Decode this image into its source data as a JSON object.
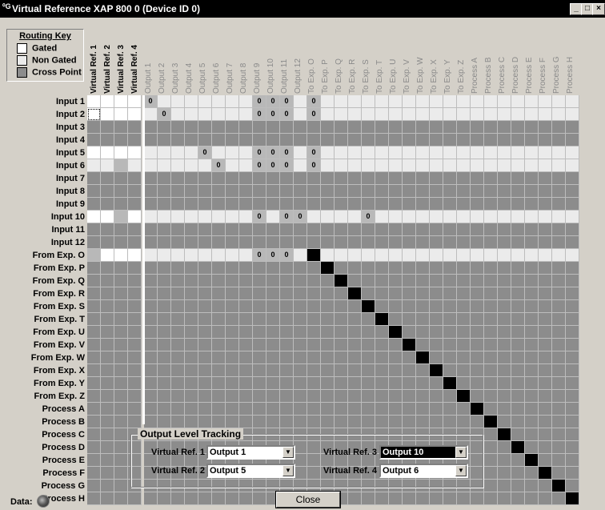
{
  "window": {
    "title": "Virtual Reference XAP 800 0 (Device ID 0)",
    "buttons": [
      "_",
      "□",
      "×"
    ]
  },
  "routing_key": {
    "title": "Routing Key",
    "items": [
      {
        "label": "Gated",
        "color": "#ffffff"
      },
      {
        "label": "Non Gated",
        "color": "#ebebeb"
      },
      {
        "label": "Cross Point",
        "color": "#8c8c8c"
      }
    ]
  },
  "columns": [
    {
      "label": "Virtual Ref. 1",
      "bold": true
    },
    {
      "label": "Virtual Ref. 2",
      "bold": true
    },
    {
      "label": "Virtual Ref. 3",
      "bold": true
    },
    {
      "label": "Virtual Ref. 4",
      "bold": true
    },
    {
      "label": "Output 1"
    },
    {
      "label": "Output 2"
    },
    {
      "label": "Output 3"
    },
    {
      "label": "Output 4"
    },
    {
      "label": "Output 5"
    },
    {
      "label": "Output 6"
    },
    {
      "label": "Output 7"
    },
    {
      "label": "Output 8"
    },
    {
      "label": "Output 9"
    },
    {
      "label": "Output 10"
    },
    {
      "label": "Output 11"
    },
    {
      "label": "Output 12"
    },
    {
      "label": "To Exp. O"
    },
    {
      "label": "To Exp. P"
    },
    {
      "label": "To Exp. Q"
    },
    {
      "label": "To Exp. R"
    },
    {
      "label": "To Exp. S"
    },
    {
      "label": "To Exp. T"
    },
    {
      "label": "To Exp. U"
    },
    {
      "label": "To Exp. V"
    },
    {
      "label": "To Exp. W"
    },
    {
      "label": "To Exp. X"
    },
    {
      "label": "To Exp. Y"
    },
    {
      "label": "To Exp. Z"
    },
    {
      "label": "Process A"
    },
    {
      "label": "Process B"
    },
    {
      "label": "Process C"
    },
    {
      "label": "Process D"
    },
    {
      "label": "Process E"
    },
    {
      "label": "Process F"
    },
    {
      "label": "Process G"
    },
    {
      "label": "Process H"
    }
  ],
  "rows": [
    "Input 1",
    "Input 2",
    "Input 3",
    "Input 4",
    "Input 5",
    "Input 6",
    "Input 7",
    "Input 8",
    "Input 9",
    "Input 10",
    "Input 11",
    "Input 12",
    "From Exp. O",
    "From Exp. P",
    "From Exp. Q",
    "From Exp. R",
    "From Exp. S",
    "From Exp. T",
    "From Exp. U",
    "From Exp. V",
    "From Exp. W",
    "From Exp. X",
    "From Exp. Y",
    "From Exp. Z",
    "Process A",
    "Process B",
    "Process C",
    "Process D",
    "Process E",
    "Process F",
    "Process G",
    "Process H"
  ],
  "active_rows": [
    0,
    1,
    4,
    5,
    9,
    12
  ],
  "row_cells": {
    "0": {
      "vref": [
        "g",
        "g",
        "g",
        "g"
      ],
      "points": {
        "4": "0",
        "12": "0",
        "13": "0",
        "14": "0",
        "16": "0"
      }
    },
    "1": {
      "vref": [
        "gd",
        "g",
        "g",
        "g"
      ],
      "points": {
        "5": "0",
        "12": "0",
        "13": "0",
        "14": "0",
        "16": "0"
      }
    },
    "4": {
      "vref": [
        "g",
        "g",
        "g",
        "g"
      ],
      "points": {
        "8": "0",
        "12": "0",
        "13": "0",
        "14": "0",
        "16": "0"
      }
    },
    "5": {
      "vref": [
        "l",
        "l",
        "p",
        "l"
      ],
      "points": {
        "9": "0",
        "12": "0",
        "13": "0",
        "14": "0",
        "16": "0"
      }
    },
    "9": {
      "vref": [
        "g",
        "g",
        "p",
        "g"
      ],
      "points": {
        "12": "0",
        "14": "0",
        "15": "0",
        "20": "0"
      }
    },
    "12": {
      "vref": [
        "p",
        "g",
        "g",
        "g"
      ],
      "points": {
        "12": "0",
        "13": "0",
        "14": "0"
      },
      "self": 16
    }
  },
  "output_level_tracking": {
    "title": "Output Level Tracking",
    "items": [
      {
        "label": "Virtual Ref. 1",
        "value": "Output 1"
      },
      {
        "label": "Virtual Ref. 2",
        "value": "Output 5"
      },
      {
        "label": "Virtual Ref. 3",
        "value": "Output 10"
      },
      {
        "label": "Virtual Ref. 4",
        "value": "Output 6"
      }
    ]
  },
  "close_label": "Close",
  "data_label": "Data:"
}
